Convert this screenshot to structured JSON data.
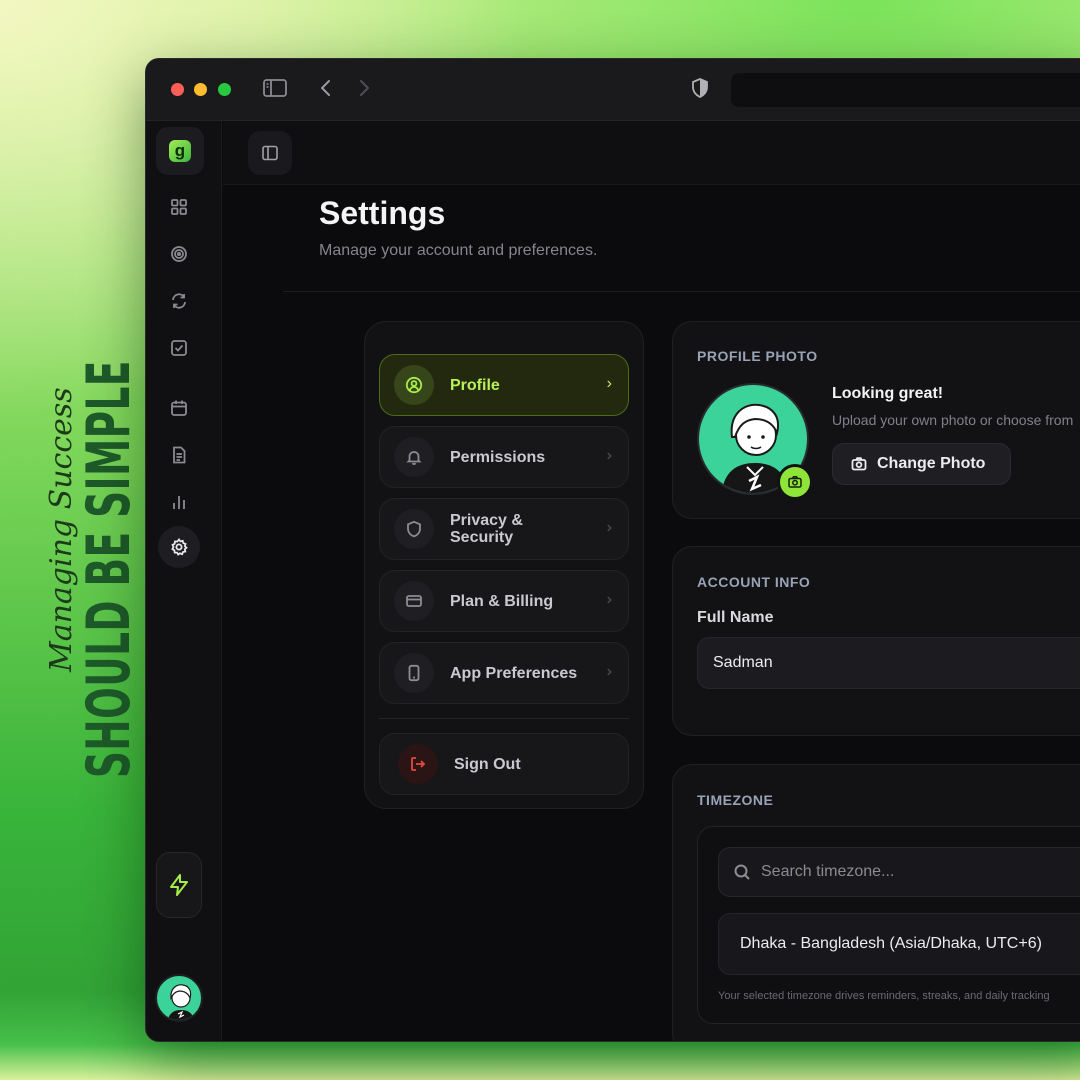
{
  "slogan": {
    "script": "Managing Success",
    "bold": "SHOULD BE SIMPLE"
  },
  "colors": {
    "accent": "#a6ec4a",
    "danger": "#e5483f",
    "window_bg": "#0b0b0e"
  },
  "rail": {
    "logo_letter": "g",
    "items": [
      {
        "icon": "dashboard-icon"
      },
      {
        "icon": "target-icon"
      },
      {
        "icon": "refresh-icon"
      },
      {
        "icon": "checkbox-icon"
      },
      {
        "icon": "calendar-icon"
      },
      {
        "icon": "document-icon"
      },
      {
        "icon": "bar-chart-icon"
      },
      {
        "icon": "gear-icon",
        "active": true
      }
    ],
    "bottom_icon": "lightning-icon"
  },
  "header": {
    "title": "Settings",
    "subtitle": "Manage your account and preferences."
  },
  "menu": {
    "items": [
      {
        "label": "Profile",
        "icon": "user-circle-icon",
        "active": true
      },
      {
        "label": "Permissions",
        "icon": "bell-icon"
      },
      {
        "label": "Privacy & Security",
        "icon": "shield-icon"
      },
      {
        "label": "Plan & Billing",
        "icon": "credit-card-icon"
      },
      {
        "label": "App Preferences",
        "icon": "phone-icon"
      }
    ],
    "sign_out": "Sign Out"
  },
  "profile_photo": {
    "heading": "PROFILE PHOTO",
    "title": "Looking great!",
    "description": "Upload your own photo or choose from",
    "button": "Change Photo"
  },
  "account_info": {
    "heading": "ACCOUNT INFO",
    "full_name_label": "Full Name",
    "full_name_value": "Sadman"
  },
  "timezone": {
    "heading": "TIMEZONE",
    "search_placeholder": "Search timezone...",
    "selected": "Dhaka - Bangladesh (Asia/Dhaka, UTC+6)",
    "note": "Your selected timezone drives reminders, streaks, and daily tracking"
  }
}
